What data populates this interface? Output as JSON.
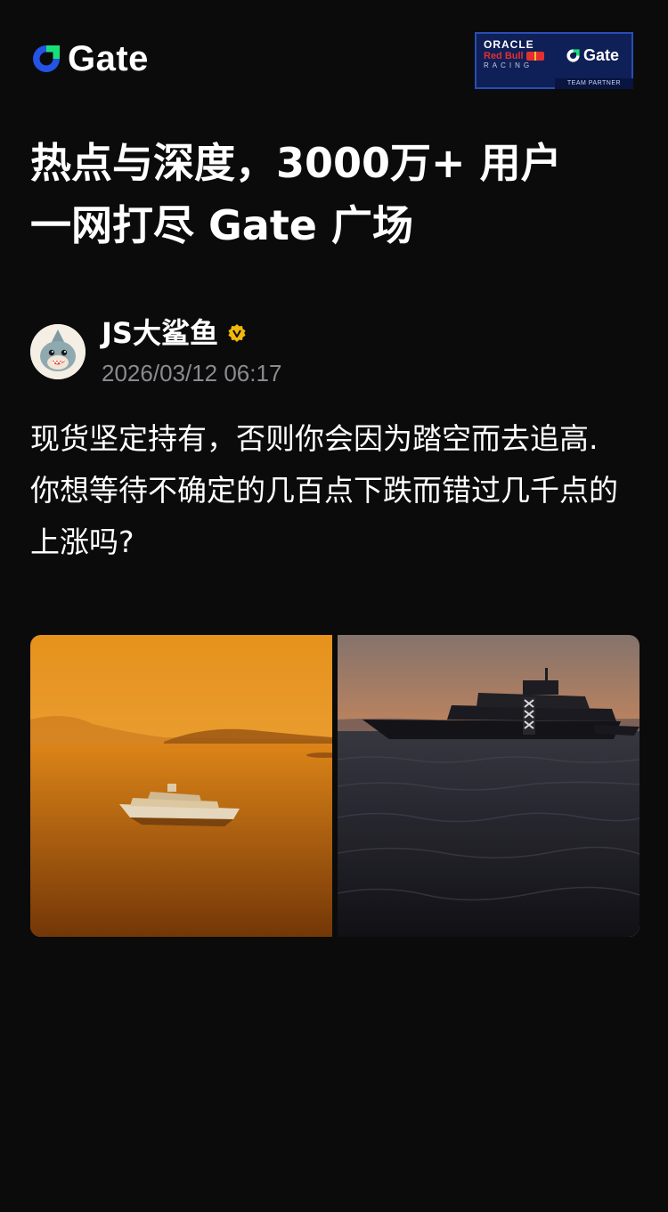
{
  "header": {
    "brand_name": "Gate",
    "brand_icon": "gate-logo-icon",
    "partner_badge": {
      "line1": "ORACLE",
      "line2": "Red Bull",
      "line3": "RACING",
      "brand": "Gate",
      "caption": "TEAM PARTNER"
    }
  },
  "headline": {
    "line1": "热点与深度，3000万+ 用户",
    "line2": "一网打尽 Gate 广场"
  },
  "post": {
    "author": {
      "name": "JS大鲨鱼",
      "avatar_icon": "shark-avatar",
      "verified_icon": "verified-badge-icon",
      "timestamp": "2026/03/12 06:17"
    },
    "body_lines": [
      "现货坚定持有，否则你会因为踏空而去追高.",
      "你想等待不确定的几百点下跌而错过几千点的上涨吗?"
    ],
    "images": [
      {
        "name": "yacht-sunset-aerial-photo"
      },
      {
        "name": "yacht-silhouette-sea-photo"
      }
    ]
  },
  "colors": {
    "background": "#0b0b0c",
    "brand_blue": "#2354e6",
    "brand_green": "#17e07a",
    "muted_text": "#8a8a90",
    "verified_gold": "#f0b90b"
  }
}
